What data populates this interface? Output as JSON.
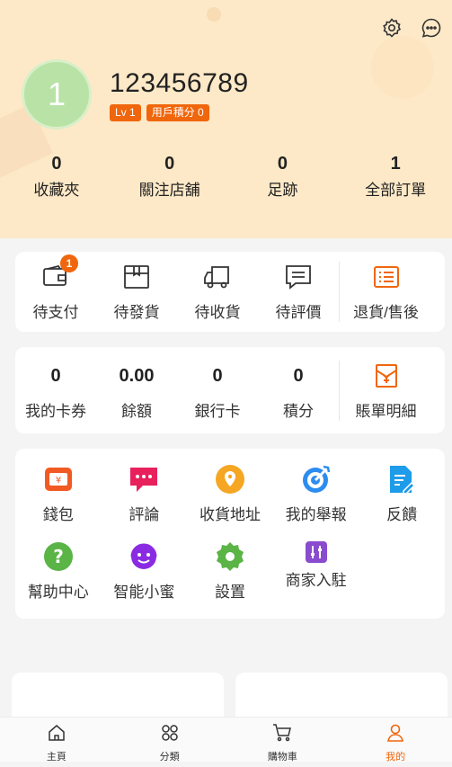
{
  "header": {
    "avatar_text": "1",
    "username": "123456789",
    "level_badge": "Lv 1",
    "points_badge": "用戶積分 0",
    "settings_icon": "gear-icon",
    "message_icon": "chat-bubble-icon"
  },
  "stats": [
    {
      "value": "0",
      "label": "收藏夾"
    },
    {
      "value": "0",
      "label": "關注店舖"
    },
    {
      "value": "0",
      "label": "足跡"
    },
    {
      "value": "1",
      "label": "全部訂單"
    }
  ],
  "orders": {
    "items": [
      {
        "label": "待支付",
        "badge": "1",
        "icon": "wallet-icon"
      },
      {
        "label": "待發貨",
        "icon": "package-icon"
      },
      {
        "label": "待收貨",
        "icon": "truck-icon"
      },
      {
        "label": "待評價",
        "icon": "comment-icon"
      }
    ],
    "after_sales": {
      "label": "退貨/售後",
      "icon": "list-icon"
    }
  },
  "wallet": {
    "items": [
      {
        "value": "0",
        "label": "我的卡券"
      },
      {
        "value": "0.00",
        "label": "餘額"
      },
      {
        "value": "0",
        "label": "銀行卡"
      },
      {
        "value": "0",
        "label": "積分"
      }
    ],
    "bill": {
      "label": "賬單明細",
      "icon": "bill-icon"
    }
  },
  "services": [
    {
      "label": "錢包",
      "icon": "wallet-icon",
      "color": "#f15a22"
    },
    {
      "label": "評論",
      "icon": "chat-icon",
      "color": "#e8205c"
    },
    {
      "label": "收貨地址",
      "icon": "location-icon",
      "color": "#f5a623"
    },
    {
      "label": "我的舉報",
      "icon": "target-icon",
      "color": "#2d8cf0"
    },
    {
      "label": "反饋",
      "icon": "edit-doc-icon",
      "color": "#1e9be9"
    },
    {
      "label": "幫助中心",
      "icon": "question-icon",
      "color": "#5ab446"
    },
    {
      "label": "智能小蜜",
      "icon": "assistant-icon",
      "color": "#8a2be2"
    },
    {
      "label": "設置",
      "icon": "gear-icon",
      "color": "#5ab446"
    },
    {
      "label": "商家入駐",
      "icon": "merchant-icon",
      "color": "#8a4ccf"
    }
  ],
  "tabbar": [
    {
      "label": "主頁",
      "icon": "home-icon",
      "active": false
    },
    {
      "label": "分類",
      "icon": "category-icon",
      "active": false
    },
    {
      "label": "購物車",
      "icon": "cart-icon",
      "active": false
    },
    {
      "label": "我的",
      "icon": "user-icon",
      "active": true
    }
  ],
  "colors": {
    "accent": "#f0660c",
    "header_bg": "#fde9c7"
  }
}
